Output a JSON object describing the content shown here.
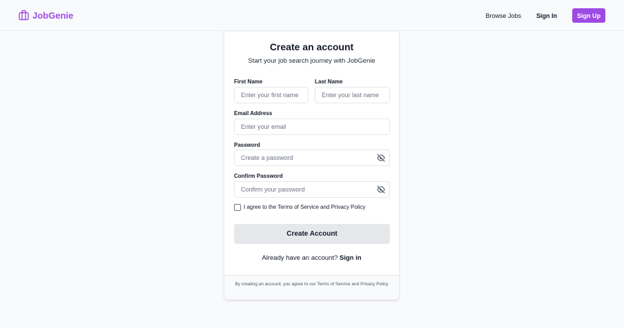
{
  "brand": {
    "name": "JobGenie",
    "icon": "briefcase-icon",
    "color": "#9d4be4"
  },
  "nav": {
    "browse_jobs": "Browse Jobs",
    "sign_in": "Sign In",
    "sign_up": "Sign Up"
  },
  "form": {
    "title": "Create an account",
    "subtitle": "Start your job search journey with JobGenie",
    "first_name": {
      "label": "First Name",
      "placeholder": "Enter your first name",
      "value": ""
    },
    "last_name": {
      "label": "Last Name",
      "placeholder": "Enter your last name",
      "value": ""
    },
    "email": {
      "label": "Email Address",
      "placeholder": "Enter your email",
      "value": ""
    },
    "password": {
      "label": "Password",
      "placeholder": "Create a password",
      "value": "",
      "toggle_icon": "eye-off-icon"
    },
    "confirm_password": {
      "label": "Confirm Password",
      "placeholder": "Confirm your password",
      "value": "",
      "toggle_icon": "eye-off-icon"
    },
    "terms": {
      "label": "I agree to the Terms of Service and Privacy Policy",
      "checked": false
    },
    "submit": "Create Account",
    "signin_prompt": "Already have an account?",
    "signin_link": "Sign in"
  },
  "footer": {
    "text": "By creating an account, you agree to our Terms of Service and Privacy Policy"
  }
}
